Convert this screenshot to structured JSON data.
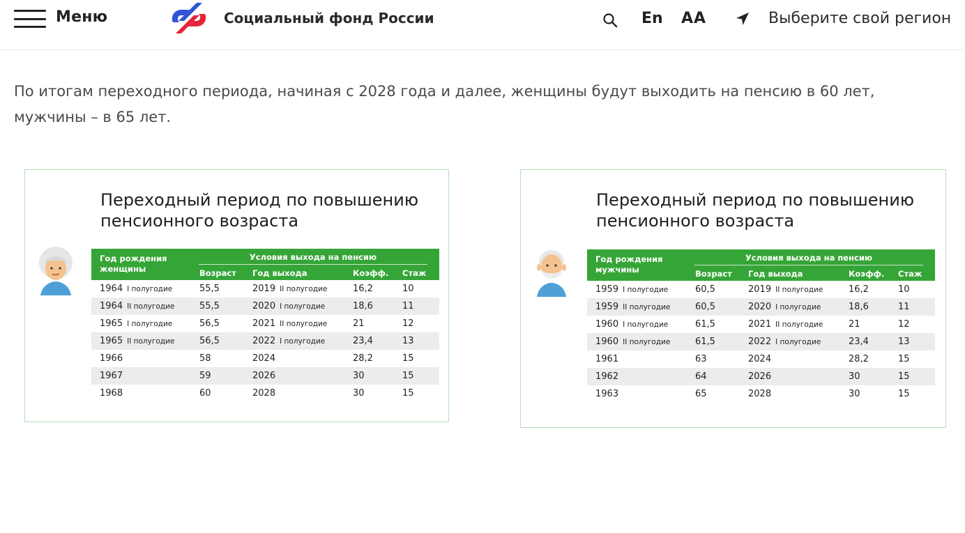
{
  "header": {
    "menu_label": "Меню",
    "org_name": "Социальный фонд России",
    "lang": "En",
    "font_size_toggle": "АА",
    "region_label": "Выберите свой регион",
    "colors": {
      "logo_blue": "#2f55d4",
      "logo_red": "#e5243b"
    }
  },
  "intro_text": "По итогам переходного периода, начиная с 2028 года и далее, женщины будут выходить на пенсию в 60 лет, мужчины – в 65 лет.",
  "tables": {
    "women": {
      "title": "Переходный период по повышению пенсионного возраста",
      "col_year": "Год рождения женщины",
      "col_conditions": "Условия выхода на пенсию",
      "col_age": "Возраст",
      "col_exit_year": "Год выхода",
      "col_coeff": "Коэфф.",
      "col_exp": "Стаж",
      "rows": [
        {
          "year": "1964",
          "year_half": "I полугодие",
          "age": "55,5",
          "exit": "2019",
          "exit_half": "II полугодие",
          "coeff": "16,2",
          "exp": "10"
        },
        {
          "year": "1964",
          "year_half": "II полугодие",
          "age": "55,5",
          "exit": "2020",
          "exit_half": "I полугодие",
          "coeff": "18,6",
          "exp": "11"
        },
        {
          "year": "1965",
          "year_half": "I полугодие",
          "age": "56,5",
          "exit": "2021",
          "exit_half": "II полугодие",
          "coeff": "21",
          "exp": "12"
        },
        {
          "year": "1965",
          "year_half": "II полугодие",
          "age": "56,5",
          "exit": "2022",
          "exit_half": "I полугодие",
          "coeff": "23,4",
          "exp": "13"
        },
        {
          "year": "1966",
          "year_half": "",
          "age": "58",
          "exit": "2024",
          "exit_half": "",
          "coeff": "28,2",
          "exp": "15"
        },
        {
          "year": "1967",
          "year_half": "",
          "age": "59",
          "exit": "2026",
          "exit_half": "",
          "coeff": "30",
          "exp": "15"
        },
        {
          "year": "1968",
          "year_half": "",
          "age": "60",
          "exit": "2028",
          "exit_half": "",
          "coeff": "30",
          "exp": "15"
        }
      ]
    },
    "men": {
      "title": "Переходный период по повышению пенсионного возраста",
      "col_year": "Год рождения мужчины",
      "col_conditions": "Условия выхода на пенсию",
      "col_age": "Возраст",
      "col_exit_year": "Год выхода",
      "col_coeff": "Коэфф.",
      "col_exp": "Стаж",
      "rows": [
        {
          "year": "1959",
          "year_half": "I полугодие",
          "age": "60,5",
          "exit": "2019",
          "exit_half": "II полугодие",
          "coeff": "16,2",
          "exp": "10"
        },
        {
          "year": "1959",
          "year_half": "II полугодие",
          "age": "60,5",
          "exit": "2020",
          "exit_half": "I полугодие",
          "coeff": "18,6",
          "exp": "11"
        },
        {
          "year": "1960",
          "year_half": "I полугодие",
          "age": "61,5",
          "exit": "2021",
          "exit_half": "II полугодие",
          "coeff": "21",
          "exp": "12"
        },
        {
          "year": "1960",
          "year_half": "II полугодие",
          "age": "61,5",
          "exit": "2022",
          "exit_half": "I полугодие",
          "coeff": "23,4",
          "exp": "13"
        },
        {
          "year": "1961",
          "year_half": "",
          "age": "63",
          "exit": "2024",
          "exit_half": "",
          "coeff": "28,2",
          "exp": "15"
        },
        {
          "year": "1962",
          "year_half": "",
          "age": "64",
          "exit": "2026",
          "exit_half": "",
          "coeff": "30",
          "exp": "15"
        },
        {
          "year": "1963",
          "year_half": "",
          "age": "65",
          "exit": "2028",
          "exit_half": "",
          "coeff": "30",
          "exp": "15"
        }
      ]
    }
  }
}
